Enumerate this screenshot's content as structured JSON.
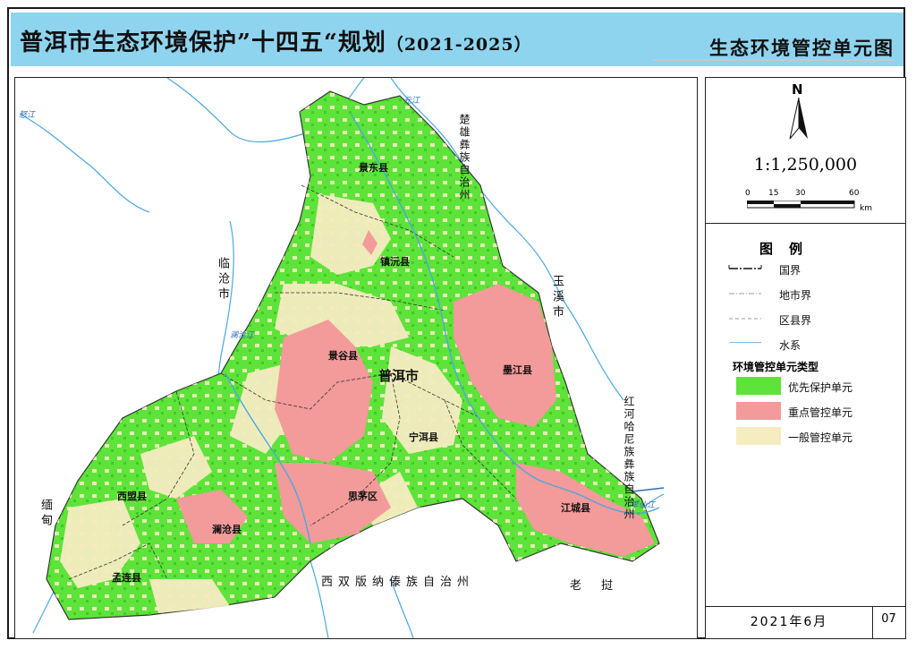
{
  "header": {
    "title": "普洱市生态环境保护”十四五“规划",
    "title_years": "（2021-2025）",
    "subtitle": "生态环境管控单元图"
  },
  "map": {
    "center_label": "普洱市",
    "counties": [
      "景东县",
      "镇沅县",
      "景谷县",
      "墨江县",
      "宁洱县",
      "思茅区",
      "江城县",
      "西盟县",
      "澜沧县",
      "孟连县"
    ],
    "neighbors": {
      "lincang": "临沧市",
      "chuxiong": "楚雄彝族自治州",
      "yuxi": "玉溪市",
      "honghe": "红河哈尼族彝族自治州",
      "xishuangbanna": "西双版纳傣族自治州",
      "laos": "老挝",
      "myanmar": "缅甸"
    },
    "rivers": [
      "怒江",
      "元江",
      "澜沧江",
      "李仙江"
    ]
  },
  "side": {
    "north": "N",
    "scale": "1:1,250,000",
    "scale_ticks": [
      "0",
      "15",
      "30",
      "60"
    ],
    "scale_unit": "km",
    "legend_title": "图例",
    "legend_lines": [
      "国界",
      "地市界",
      "区县界",
      "水系"
    ],
    "unit_type_title": "环境管控单元类型",
    "units": [
      {
        "label": "优先保护单元",
        "color": "#5ee33a"
      },
      {
        "label": "重点管控单元",
        "color": "#f39a9a"
      },
      {
        "label": "一般管控单元",
        "color": "#f5ecc0"
      }
    ],
    "date": "2021年6月",
    "page": "07"
  },
  "colors": {
    "header_bg": "#8fd4ef",
    "priority": "#5ee33a",
    "key": "#f39a9a",
    "general": "#f5ecc0",
    "river": "#4aa8e0"
  }
}
